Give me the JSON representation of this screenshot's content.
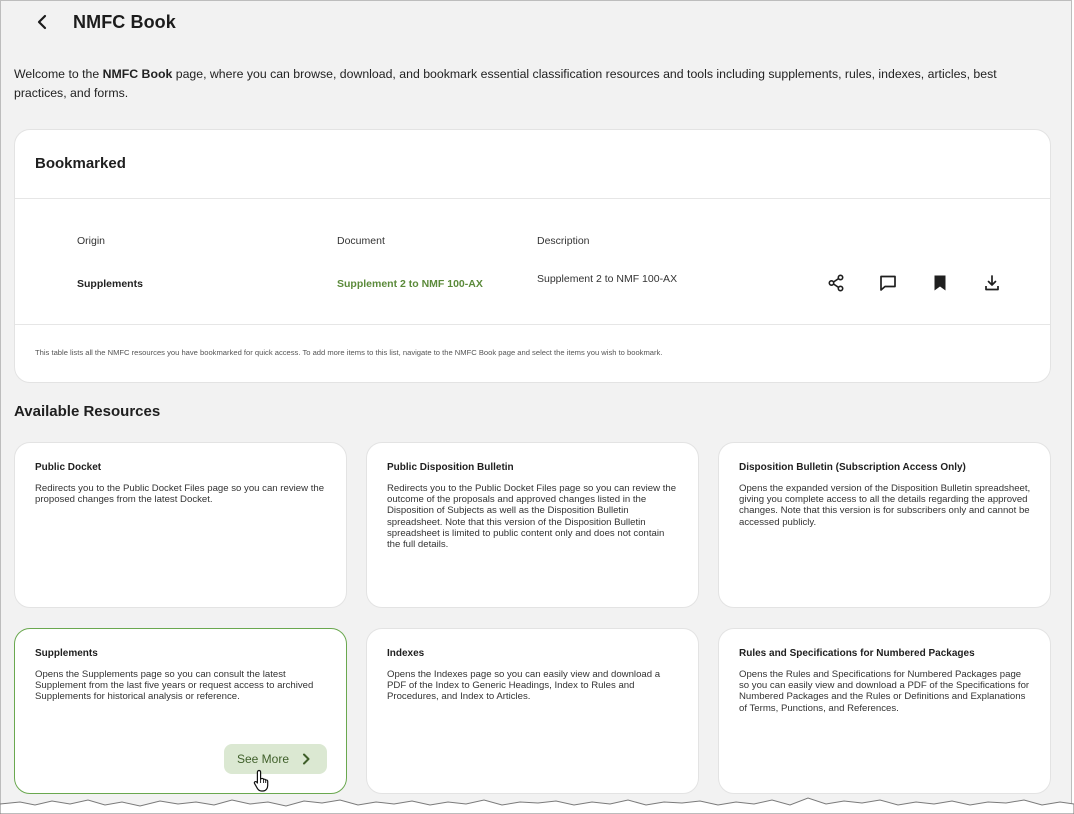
{
  "header": {
    "back_icon": "chevron-left-icon",
    "title": "NMFC Book"
  },
  "intro": {
    "pre": "Welcome to the ",
    "bold": "NMFC Book",
    "post": " page, where you can browse, download, and bookmark essential classification resources and tools including supplements, rules, indexes, articles, best practices, and forms."
  },
  "bookmarked": {
    "title": "Bookmarked",
    "columns": [
      "Origin",
      "Document",
      "Description"
    ],
    "rows": [
      {
        "origin": "Supplements",
        "document": "Supplement 2 to NMF 100-AX",
        "description": "Supplement 2 to NMF 100-AX",
        "actions": [
          "share-icon",
          "comment-icon",
          "bookmark-icon",
          "download-icon"
        ]
      }
    ],
    "footnote": "This table lists all the NMFC resources you have bookmarked for quick access. To add more items to this list, navigate to the NMFC Book page and select the items you wish to bookmark."
  },
  "available": {
    "title": "Available Resources",
    "cards": [
      {
        "title": "Public Docket",
        "description": "Redirects you to the Public Docket Files page so you can review the proposed changes from the latest Docket."
      },
      {
        "title": "Public Disposition Bulletin",
        "description": "Redirects you to the Public Docket Files page so you can review the outcome of the proposals and approved changes listed in the Disposition of Subjects as well as the Disposition Bulletin spreadsheet. Note that this version of the Disposition Bulletin spreadsheet is limited to public content only and does not contain the full details."
      },
      {
        "title": "Disposition Bulletin (Subscription Access Only)",
        "description": "Opens the expanded version of the Disposition Bulletin spreadsheet, giving you complete access to all the details regarding the approved changes. Note that this version is for subscribers only and cannot be accessed publicly."
      },
      {
        "title": "Supplements",
        "description": "Opens the Supplements page so you can consult the latest Supplement from the last five years or request access to archived Supplements for historical analysis or reference.",
        "button": "See More"
      },
      {
        "title": "Indexes",
        "description": "Opens the Indexes page so you can easily view and download a PDF of the Index to Generic Headings, Index to Rules and Procedures, and Index to Articles."
      },
      {
        "title": "Rules and Specifications for Numbered Packages",
        "description": "Opens the Rules and Specifications for Numbered Packages page so you can easily view and download a PDF of the Specifications for Numbered Packages and the Rules or Definitions and Explanations of Terms, Punctions, and References."
      }
    ]
  },
  "colors": {
    "page_bg": "#f2f2f2",
    "card_bg": "#ffffff",
    "accent_green": "#5b8a3a",
    "active_border": "#6aa84f",
    "button_bg": "#dbe8d2"
  }
}
